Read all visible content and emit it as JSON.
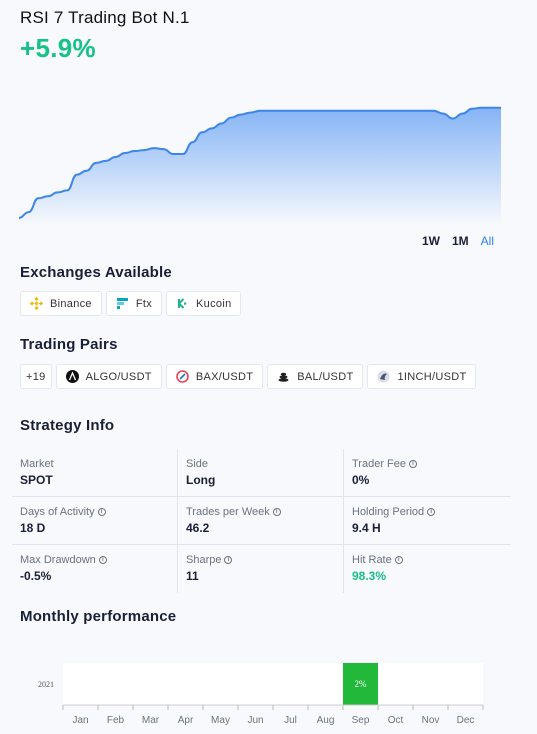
{
  "bot": {
    "title": "RSI 7 Trading Bot N.1",
    "return": "+5.9%"
  },
  "ranges": [
    {
      "label": "1W",
      "active": false
    },
    {
      "label": "1M",
      "active": false
    },
    {
      "label": "All",
      "active": true
    }
  ],
  "exchanges": {
    "title": "Exchanges Available",
    "items": [
      {
        "label": "Binance",
        "icon": "binance-icon"
      },
      {
        "label": "Ftx",
        "icon": "ftx-icon"
      },
      {
        "label": "Kucoin",
        "icon": "kucoin-icon"
      }
    ]
  },
  "pairs": {
    "title": "Trading Pairs",
    "more": "+19",
    "items": [
      {
        "label": "ALGO/USDT",
        "icon": "algo-icon"
      },
      {
        "label": "BAX/USDT",
        "icon": "bax-icon"
      },
      {
        "label": "BAL/USDT",
        "icon": "bal-icon"
      },
      {
        "label": "1INCH/USDT",
        "icon": "1inch-icon"
      }
    ]
  },
  "strategy": {
    "title": "Strategy Info",
    "fields": [
      {
        "label": "Market",
        "value": "SPOT",
        "info": false
      },
      {
        "label": "Side",
        "value": "Long",
        "info": false
      },
      {
        "label": "Trader Fee",
        "value": "0%",
        "info": true
      },
      {
        "label": "Days of Activity",
        "value": "18 D",
        "info": true
      },
      {
        "label": "Trades per Week",
        "value": "46.2",
        "info": true
      },
      {
        "label": "Holding Period",
        "value": "9.4 H",
        "info": true
      },
      {
        "label": "Max Drawdown",
        "value": "-0.5%",
        "info": true
      },
      {
        "label": "Sharpe",
        "value": "11",
        "info": true
      },
      {
        "label": "Hit Rate",
        "value": "98.3%",
        "info": true,
        "highlight": true
      }
    ]
  },
  "monthly": {
    "title": "Monthly performance",
    "year": "2021",
    "months": [
      "Jan",
      "Feb",
      "Mar",
      "Apr",
      "May",
      "Jun",
      "Jul",
      "Aug",
      "Sep",
      "Oct",
      "Nov",
      "Dec"
    ],
    "values": [
      null,
      null,
      null,
      null,
      null,
      null,
      null,
      null,
      "2%",
      null,
      null,
      null
    ]
  },
  "colors": {
    "green": "#17c287",
    "blue": "#2d7ff9",
    "cellGreen": "#22b83a"
  },
  "chart_data": {
    "type": "area",
    "ylim": [
      0,
      6.5
    ],
    "values": [
      0,
      0.3,
      1,
      1.1,
      1.3,
      1.4,
      2.2,
      2.4,
      2.8,
      2.9,
      3.1,
      3.3,
      3.4,
      3.45,
      3.55,
      3.5,
      3.25,
      3.25,
      3.85,
      4.35,
      4.55,
      4.8,
      5.1,
      5.25,
      5.35,
      5.45,
      5.45,
      5.45,
      5.45,
      5.45,
      5.45,
      5.45,
      5.45,
      5.45,
      5.45,
      5.45,
      5.45,
      5.45,
      5.45,
      5.45,
      5.45,
      5.45,
      5.45,
      5.45,
      5.3,
      5.05,
      5.3,
      5.55,
      5.6,
      5.6,
      5.6
    ]
  }
}
